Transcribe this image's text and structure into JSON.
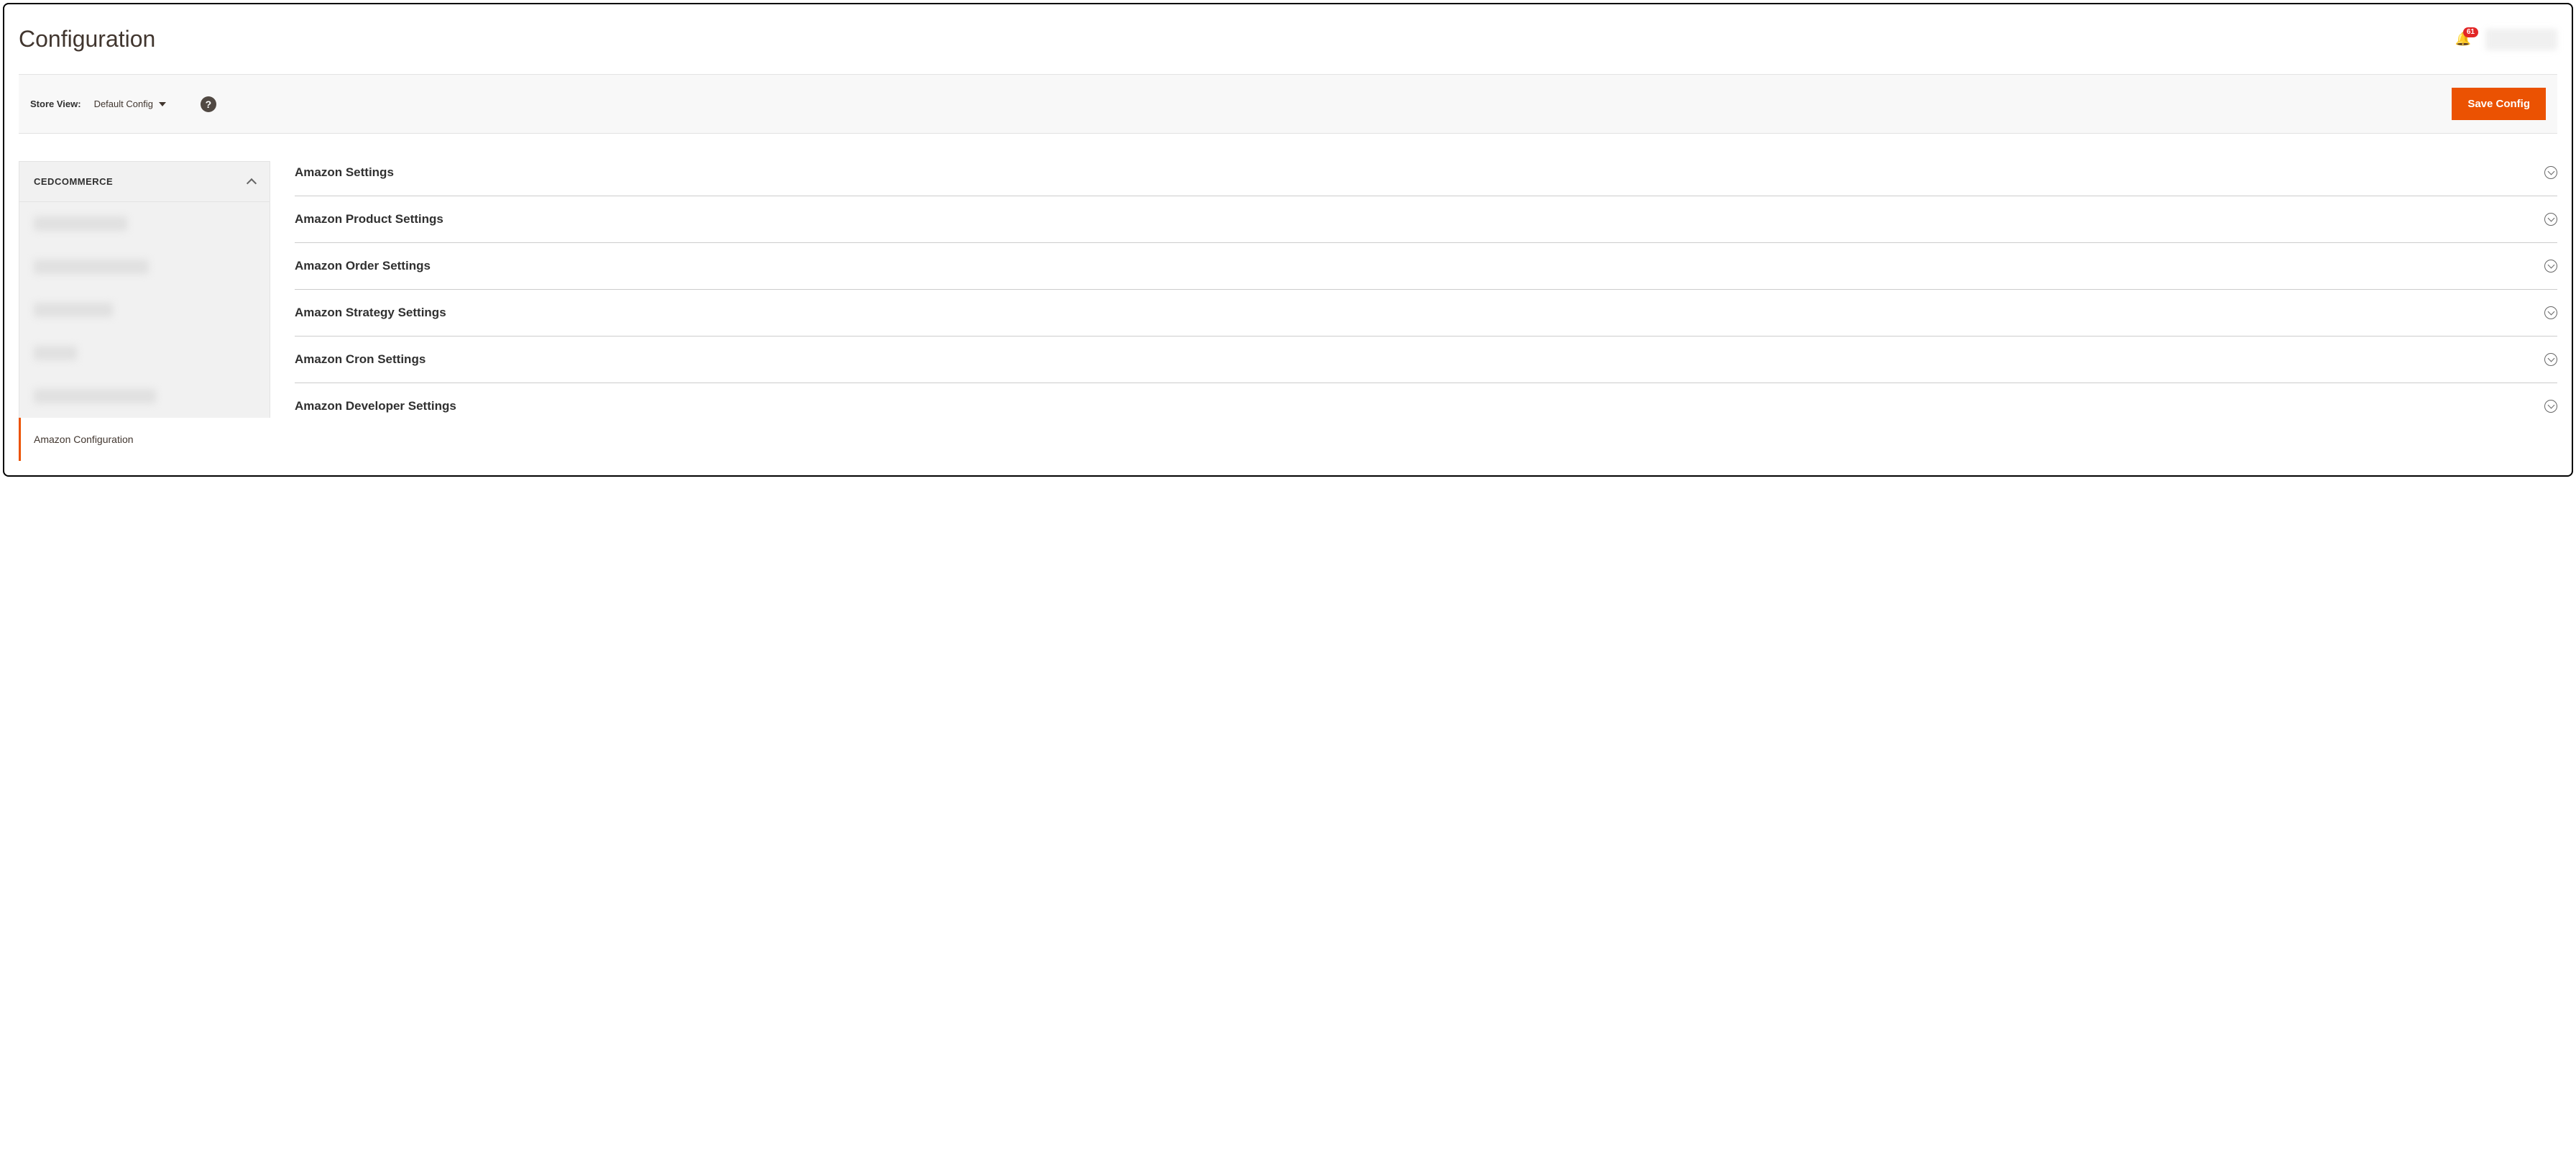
{
  "header": {
    "title": "Configuration",
    "notification_count": "61"
  },
  "toolbar": {
    "store_view_label": "Store View:",
    "store_view_value": "Default Config",
    "save_button_label": "Save Config"
  },
  "sidebar": {
    "group_title": "CEDCOMMERCE",
    "active_item": "Amazon Configuration"
  },
  "sections": [
    {
      "title": "Amazon Settings"
    },
    {
      "title": "Amazon Product Settings"
    },
    {
      "title": "Amazon Order Settings"
    },
    {
      "title": "Amazon Strategy Settings"
    },
    {
      "title": "Amazon Cron Settings"
    },
    {
      "title": "Amazon Developer Settings"
    }
  ]
}
